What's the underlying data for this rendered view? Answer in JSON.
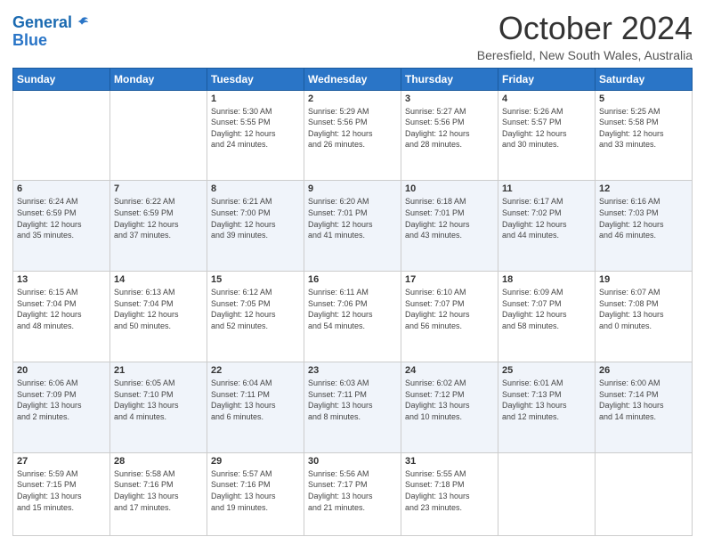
{
  "logo": {
    "line1": "General",
    "line2": "Blue"
  },
  "title": "October 2024",
  "subtitle": "Beresfield, New South Wales, Australia",
  "headers": [
    "Sunday",
    "Monday",
    "Tuesday",
    "Wednesday",
    "Thursday",
    "Friday",
    "Saturday"
  ],
  "weeks": [
    [
      {
        "num": "",
        "info": ""
      },
      {
        "num": "",
        "info": ""
      },
      {
        "num": "1",
        "info": "Sunrise: 5:30 AM\nSunset: 5:55 PM\nDaylight: 12 hours\nand 24 minutes."
      },
      {
        "num": "2",
        "info": "Sunrise: 5:29 AM\nSunset: 5:56 PM\nDaylight: 12 hours\nand 26 minutes."
      },
      {
        "num": "3",
        "info": "Sunrise: 5:27 AM\nSunset: 5:56 PM\nDaylight: 12 hours\nand 28 minutes."
      },
      {
        "num": "4",
        "info": "Sunrise: 5:26 AM\nSunset: 5:57 PM\nDaylight: 12 hours\nand 30 minutes."
      },
      {
        "num": "5",
        "info": "Sunrise: 5:25 AM\nSunset: 5:58 PM\nDaylight: 12 hours\nand 33 minutes."
      }
    ],
    [
      {
        "num": "6",
        "info": "Sunrise: 6:24 AM\nSunset: 6:59 PM\nDaylight: 12 hours\nand 35 minutes."
      },
      {
        "num": "7",
        "info": "Sunrise: 6:22 AM\nSunset: 6:59 PM\nDaylight: 12 hours\nand 37 minutes."
      },
      {
        "num": "8",
        "info": "Sunrise: 6:21 AM\nSunset: 7:00 PM\nDaylight: 12 hours\nand 39 minutes."
      },
      {
        "num": "9",
        "info": "Sunrise: 6:20 AM\nSunset: 7:01 PM\nDaylight: 12 hours\nand 41 minutes."
      },
      {
        "num": "10",
        "info": "Sunrise: 6:18 AM\nSunset: 7:01 PM\nDaylight: 12 hours\nand 43 minutes."
      },
      {
        "num": "11",
        "info": "Sunrise: 6:17 AM\nSunset: 7:02 PM\nDaylight: 12 hours\nand 44 minutes."
      },
      {
        "num": "12",
        "info": "Sunrise: 6:16 AM\nSunset: 7:03 PM\nDaylight: 12 hours\nand 46 minutes."
      }
    ],
    [
      {
        "num": "13",
        "info": "Sunrise: 6:15 AM\nSunset: 7:04 PM\nDaylight: 12 hours\nand 48 minutes."
      },
      {
        "num": "14",
        "info": "Sunrise: 6:13 AM\nSunset: 7:04 PM\nDaylight: 12 hours\nand 50 minutes."
      },
      {
        "num": "15",
        "info": "Sunrise: 6:12 AM\nSunset: 7:05 PM\nDaylight: 12 hours\nand 52 minutes."
      },
      {
        "num": "16",
        "info": "Sunrise: 6:11 AM\nSunset: 7:06 PM\nDaylight: 12 hours\nand 54 minutes."
      },
      {
        "num": "17",
        "info": "Sunrise: 6:10 AM\nSunset: 7:07 PM\nDaylight: 12 hours\nand 56 minutes."
      },
      {
        "num": "18",
        "info": "Sunrise: 6:09 AM\nSunset: 7:07 PM\nDaylight: 12 hours\nand 58 minutes."
      },
      {
        "num": "19",
        "info": "Sunrise: 6:07 AM\nSunset: 7:08 PM\nDaylight: 13 hours\nand 0 minutes."
      }
    ],
    [
      {
        "num": "20",
        "info": "Sunrise: 6:06 AM\nSunset: 7:09 PM\nDaylight: 13 hours\nand 2 minutes."
      },
      {
        "num": "21",
        "info": "Sunrise: 6:05 AM\nSunset: 7:10 PM\nDaylight: 13 hours\nand 4 minutes."
      },
      {
        "num": "22",
        "info": "Sunrise: 6:04 AM\nSunset: 7:11 PM\nDaylight: 13 hours\nand 6 minutes."
      },
      {
        "num": "23",
        "info": "Sunrise: 6:03 AM\nSunset: 7:11 PM\nDaylight: 13 hours\nand 8 minutes."
      },
      {
        "num": "24",
        "info": "Sunrise: 6:02 AM\nSunset: 7:12 PM\nDaylight: 13 hours\nand 10 minutes."
      },
      {
        "num": "25",
        "info": "Sunrise: 6:01 AM\nSunset: 7:13 PM\nDaylight: 13 hours\nand 12 minutes."
      },
      {
        "num": "26",
        "info": "Sunrise: 6:00 AM\nSunset: 7:14 PM\nDaylight: 13 hours\nand 14 minutes."
      }
    ],
    [
      {
        "num": "27",
        "info": "Sunrise: 5:59 AM\nSunset: 7:15 PM\nDaylight: 13 hours\nand 15 minutes."
      },
      {
        "num": "28",
        "info": "Sunrise: 5:58 AM\nSunset: 7:16 PM\nDaylight: 13 hours\nand 17 minutes."
      },
      {
        "num": "29",
        "info": "Sunrise: 5:57 AM\nSunset: 7:16 PM\nDaylight: 13 hours\nand 19 minutes."
      },
      {
        "num": "30",
        "info": "Sunrise: 5:56 AM\nSunset: 7:17 PM\nDaylight: 13 hours\nand 21 minutes."
      },
      {
        "num": "31",
        "info": "Sunrise: 5:55 AM\nSunset: 7:18 PM\nDaylight: 13 hours\nand 23 minutes."
      },
      {
        "num": "",
        "info": ""
      },
      {
        "num": "",
        "info": ""
      }
    ]
  ]
}
